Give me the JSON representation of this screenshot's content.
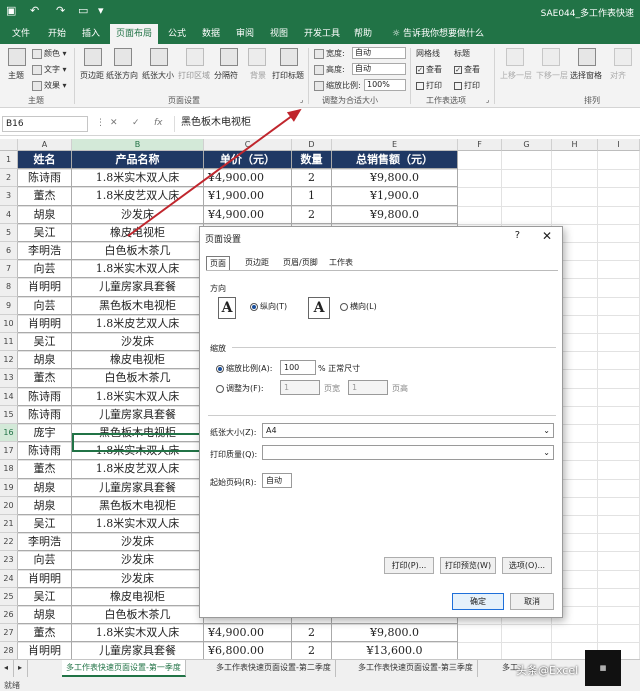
{
  "titlebar": {
    "doc_name": "SAE044_多工作表快速"
  },
  "tabs": [
    "文件",
    "开始",
    "插入",
    "页面布局",
    "公式",
    "数据",
    "审阅",
    "视图",
    "开发工具",
    "帮助"
  ],
  "active_tab": "页面布局",
  "tell_me": "告诉我你想要做什么",
  "ribbon": {
    "theme_group": {
      "label": "主题",
      "themes": "主题",
      "colors": "颜色",
      "fonts": "文字",
      "effects": "效果"
    },
    "page_setup": {
      "label": "页面设置",
      "margins": "页边距",
      "orientation": "纸张方向",
      "size": "纸张大小",
      "print_area": "打印区域",
      "breaks": "分隔符",
      "background": "背景",
      "print_titles": "打印标题"
    },
    "scale": {
      "label": "调整为合适大小",
      "width_label": "宽度:",
      "width_value": "自动",
      "height_label": "高度:",
      "height_value": "自动",
      "scale_label": "缩放比例:",
      "scale_value": "100%"
    },
    "sheet_options": {
      "label": "工作表选项",
      "gridlines": "网格线",
      "headings": "标题",
      "view": "查看",
      "print": "打印"
    },
    "arrange": {
      "label": "排列",
      "bring_forward": "上移一层",
      "send_backward": "下移一层",
      "selection_pane": "选择窗格",
      "align": "对齐"
    }
  },
  "formula_bar": {
    "cell_ref": "B16",
    "content": "黑色板木电视柜"
  },
  "columns": [
    "A",
    "B",
    "C",
    "D",
    "E",
    "F",
    "G",
    "H",
    "I"
  ],
  "table": {
    "headers": [
      "姓名",
      "产品名称",
      "单价（元）",
      "数量",
      "总销售额（元）"
    ],
    "rows": [
      [
        "陈诗雨",
        "1.8米实木双人床",
        "¥4,900.00",
        "2",
        "¥9,800.0"
      ],
      [
        "董杰",
        "1.8米皮艺双人床",
        "¥1,900.00",
        "1",
        "¥1,900.0"
      ],
      [
        "胡泉",
        "沙发床",
        "¥4,900.00",
        "2",
        "¥9,800.0"
      ],
      [
        "吴江",
        "橡皮电视柜",
        "",
        "",
        ""
      ],
      [
        "李明浩",
        "白色板木茶几",
        "",
        "",
        ""
      ],
      [
        "向芸",
        "1.8米实木双人床",
        "",
        "",
        ""
      ],
      [
        "肖明明",
        "儿童房家具套餐",
        "",
        "",
        ""
      ],
      [
        "向芸",
        "黑色板木电视柜",
        "",
        "",
        ""
      ],
      [
        "肖明明",
        "1.8米皮艺双人床",
        "",
        "",
        ""
      ],
      [
        "吴江",
        "沙发床",
        "",
        "",
        ""
      ],
      [
        "胡泉",
        "橡皮电视柜",
        "",
        "",
        ""
      ],
      [
        "董杰",
        "白色板木茶几",
        "",
        "",
        ""
      ],
      [
        "陈诗雨",
        "1.8米实木双人床",
        "",
        "",
        ""
      ],
      [
        "陈诗雨",
        "儿童房家具套餐",
        "",
        "",
        ""
      ],
      [
        "庞宇",
        "黑色板木电视柜",
        "",
        "",
        ""
      ],
      [
        "陈诗雨",
        "1.8米实木双人床",
        "",
        "",
        ""
      ],
      [
        "董杰",
        "1.8米皮艺双人床",
        "",
        "",
        ""
      ],
      [
        "胡泉",
        "儿童房家具套餐",
        "",
        "",
        ""
      ],
      [
        "胡泉",
        "黑色板木电视柜",
        "",
        "",
        ""
      ],
      [
        "吴江",
        "1.8米实木双人床",
        "",
        "",
        ""
      ],
      [
        "李明浩",
        "沙发床",
        "",
        "",
        ""
      ],
      [
        "向芸",
        "沙发床",
        "",
        "",
        ""
      ],
      [
        "肖明明",
        "沙发床",
        "",
        "",
        ""
      ],
      [
        "吴江",
        "橡皮电视柜",
        "",
        "",
        ""
      ],
      [
        "胡泉",
        "白色板木茶几",
        "",
        "",
        ""
      ],
      [
        "董杰",
        "1.8米实木双人床",
        "¥4,900.00",
        "2",
        "¥9,800.0"
      ],
      [
        "肖明明",
        "儿童房家具套餐",
        "¥6,800.00",
        "2",
        "¥13,600.0"
      ],
      [
        "陈诗雨",
        "1.8米实木双人床",
        "¥4,900.00",
        "2",
        "¥9,800.0"
      ]
    ]
  },
  "dialog": {
    "title": "页面设置",
    "help": "?",
    "close": "✕",
    "tabs": [
      "页面",
      "页边距",
      "页眉/页脚",
      "工作表"
    ],
    "orientation_label": "方向",
    "portrait": "纵向(T)",
    "landscape": "横向(L)",
    "page_icon": "A",
    "scaling_label": "缩放",
    "adjust_to": "缩放比例(A):",
    "adjust_value": "100",
    "adjust_suffix": "% 正常尺寸",
    "fit_to": "调整为(F):",
    "fit_wide": "1",
    "fit_wide_label": "页宽",
    "fit_tall": "1",
    "fit_tall_label": "页高",
    "paper_size_label": "纸张大小(Z):",
    "paper_size_value": "A4",
    "print_quality_label": "打印质量(Q):",
    "print_quality_value": "",
    "first_page_label": "起始页码(R):",
    "first_page_value": "自动",
    "print_btn": "打印(P)...",
    "preview_btn": "打印预览(W)",
    "options_btn": "选项(O)...",
    "ok_btn": "确定",
    "cancel_btn": "取消"
  },
  "annotation": {
    "step2": "2"
  },
  "sheet_tabs": [
    "多工作表快速页面设置-第一季度",
    "多工作表快速页面设置-第二季度",
    "多工作表快速页面设置-第三季度",
    "多工"
  ],
  "status": "就绪",
  "watermark": "头条@Excel"
}
